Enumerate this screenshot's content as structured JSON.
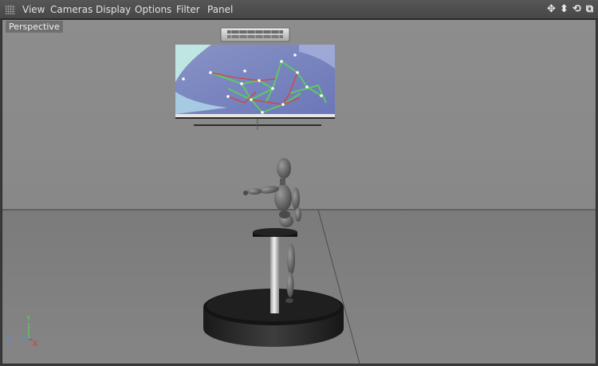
{
  "menubar": {
    "items": [
      "View",
      "Cameras",
      "Display",
      "Options",
      "Filter",
      "Panel"
    ],
    "icons": [
      "move-view-icon",
      "dolly-icon",
      "rotate-view-icon",
      "toggle-layout-icon"
    ]
  },
  "viewport": {
    "camera_label": "Perspective",
    "axis_labels": {
      "y": "Y",
      "z": "Z",
      "x": "X"
    }
  },
  "colors": {
    "menubar": "#4f4f4f",
    "viewport_bg": "#8c8c8c",
    "axis_x": "#d03a3a",
    "axis_y": "#5ccf5c",
    "axis_z": "#5a8be0"
  }
}
